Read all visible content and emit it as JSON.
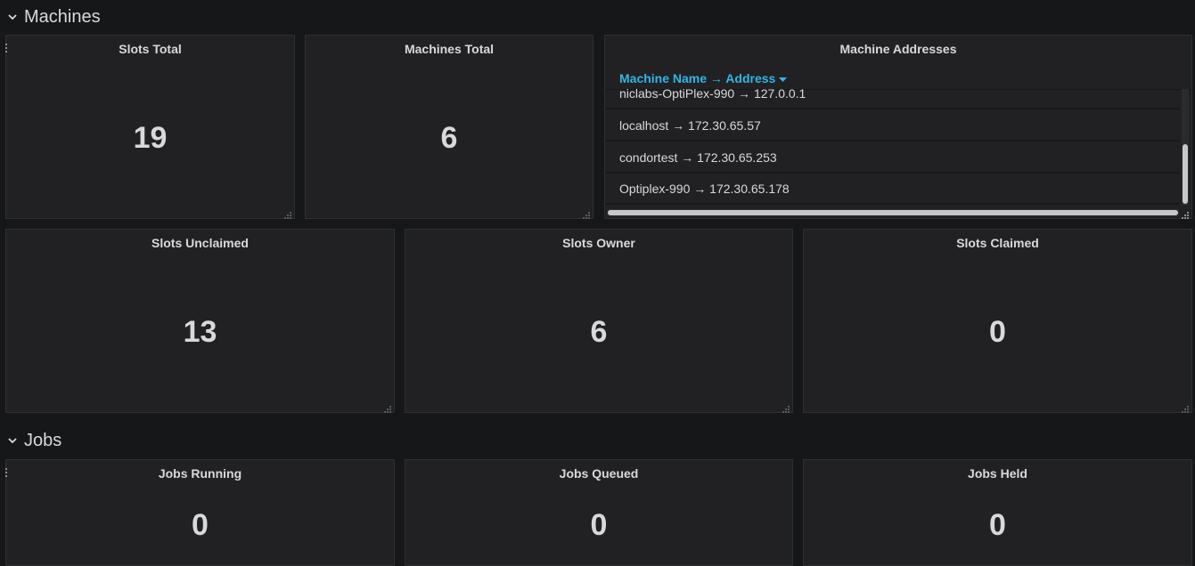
{
  "rows": {
    "machines": {
      "title": "Machines"
    },
    "jobs": {
      "title": "Jobs"
    }
  },
  "panels": {
    "slots_total": {
      "title": "Slots Total",
      "value": "19"
    },
    "machines_total": {
      "title": "Machines Total",
      "value": "6"
    },
    "machine_addresses": {
      "title": "Machine Addresses",
      "column_header": "Machine Name → Address",
      "rows": [
        "niclabs-OptiPlex-990 → 127.0.0.1",
        "localhost → 172.30.65.57",
        "condortest → 172.30.65.253",
        "Optiplex-990 → 172.30.65.178"
      ]
    },
    "slots_unclaimed": {
      "title": "Slots Unclaimed",
      "value": "13"
    },
    "slots_owner": {
      "title": "Slots Owner",
      "value": "6"
    },
    "slots_claimed": {
      "title": "Slots Claimed",
      "value": "0"
    },
    "jobs_running": {
      "title": "Jobs Running",
      "value": "0"
    },
    "jobs_queued": {
      "title": "Jobs Queued",
      "value": "0"
    },
    "jobs_held": {
      "title": "Jobs Held",
      "value": "0"
    }
  },
  "colors": {
    "background": "#161719",
    "panel": "#212124",
    "text": "#d8d9da",
    "link": "#33b5e5"
  },
  "icons": {
    "row_toggle": "chevron-down-icon",
    "sort": "caret-down-icon",
    "resize": "resize-grip-icon",
    "drag": "drag-handle-icon"
  }
}
